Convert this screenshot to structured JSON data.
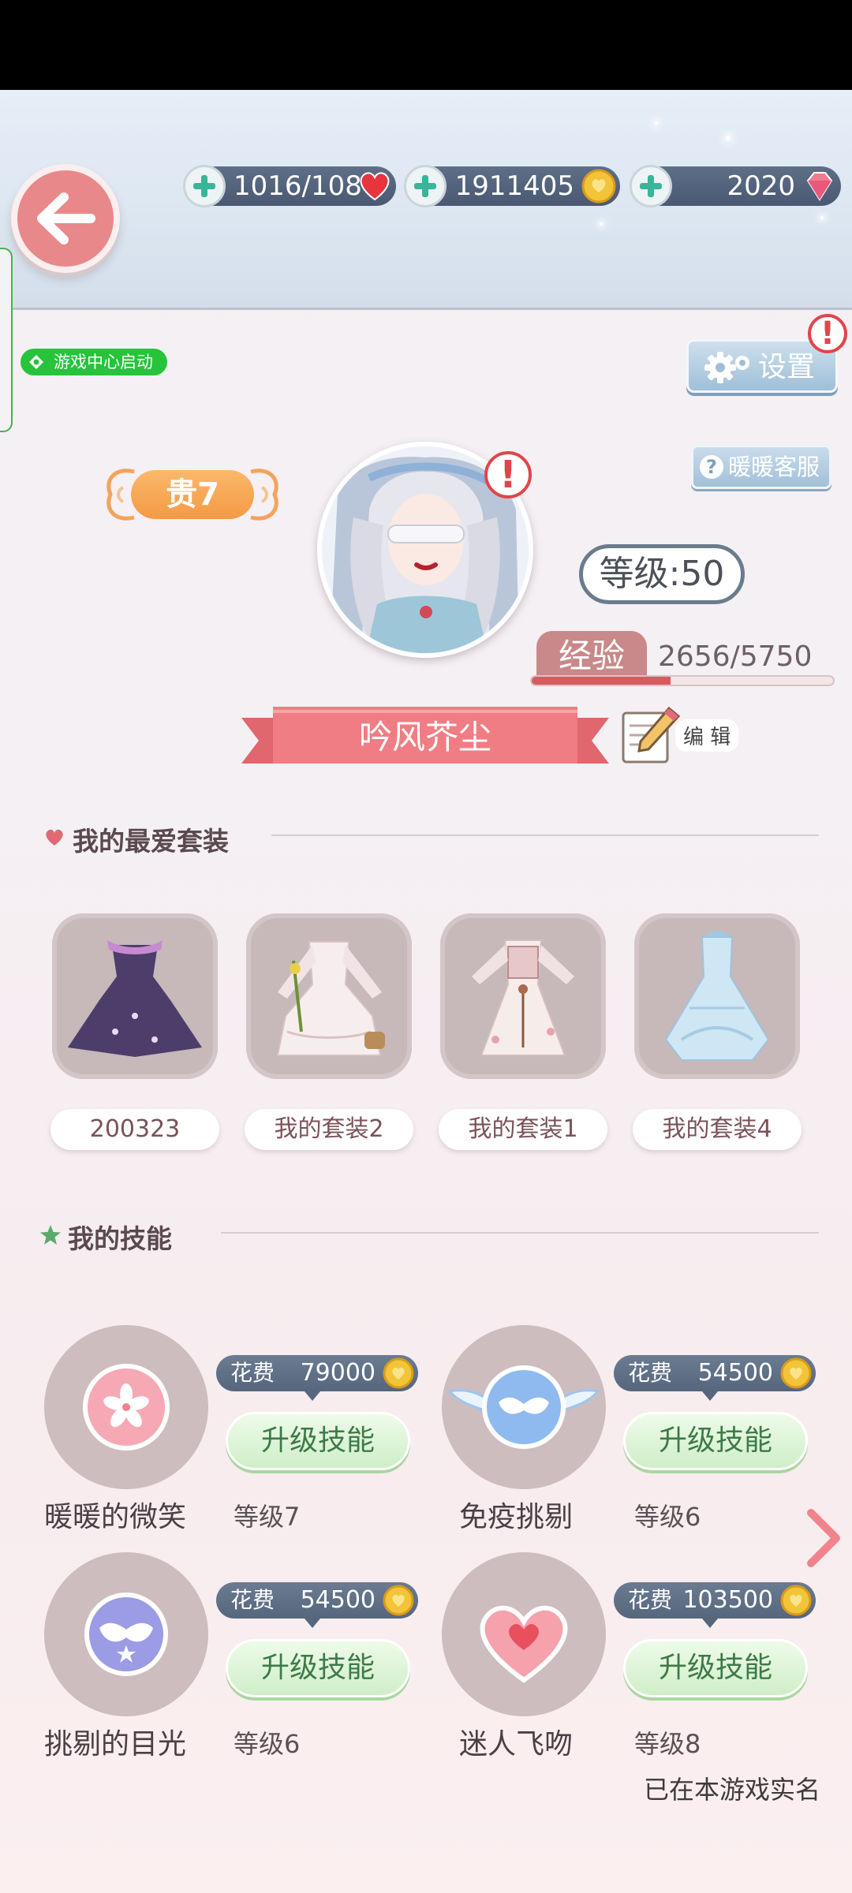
{
  "resources": {
    "stamina": "1016/108",
    "gold": "1911405",
    "diamonds": "2020"
  },
  "game_center_label": "游戏中心启动",
  "settings_label": "设置",
  "customer_service_label": "暖暖客服",
  "vip_label": "贵7",
  "level_label": "等级:50",
  "exp": {
    "label": "经验",
    "value": "2656/5750",
    "progress": 0.46
  },
  "player_name": "吟风芥尘",
  "edit_label": "编 辑",
  "favorite_outfits": {
    "title": "我的最爱套装",
    "items": [
      {
        "label": "200323"
      },
      {
        "label": "我的套装2"
      },
      {
        "label": "我的套装1"
      },
      {
        "label": "我的套装4"
      }
    ]
  },
  "skills": {
    "title": "我的技能",
    "cost_label": "花费",
    "upgrade_label": "升级技能",
    "items": [
      {
        "name": "暖暖的微笑",
        "level": "等级7",
        "cost": "79000",
        "icon": "sakura-icon"
      },
      {
        "name": "免疫挑剔",
        "level": "等级6",
        "cost": "54500",
        "icon": "winged-mask-icon"
      },
      {
        "name": "挑剔的目光",
        "level": "等级6",
        "cost": "54500",
        "icon": "mask-icon"
      },
      {
        "name": "迷人飞吻",
        "level": "等级8",
        "cost": "103500",
        "icon": "heart-icon"
      }
    ]
  },
  "realname_notice": "已在本游戏实名"
}
